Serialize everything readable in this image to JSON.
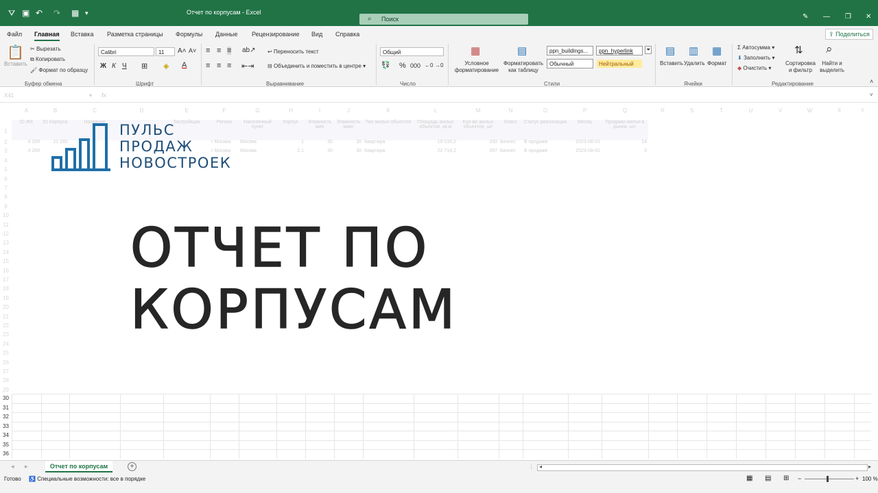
{
  "titlebar": {
    "document_title": "Отчет по корпусам  -  Excel",
    "search_placeholder": "Поиск"
  },
  "menu": {
    "tabs": [
      "Файл",
      "Главная",
      "Вставка",
      "Разметка страницы",
      "Формулы",
      "Данные",
      "Рецензирование",
      "Вид",
      "Справка"
    ],
    "active_tab": "Главная",
    "share_label": "Поделиться"
  },
  "ribbon": {
    "clipboard": {
      "paste": "Вставить",
      "cut": "Вырезать",
      "copy": "Копировать",
      "format_painter": "Формат по образцу",
      "group": "Буфер обмена"
    },
    "font": {
      "name": "Calibri",
      "size": "11",
      "bold": "Ж",
      "italic": "К",
      "underline": "Ч",
      "group": "Шрифт"
    },
    "alignment": {
      "wrap": "Переносить текст",
      "merge": "Объединить и поместить в центре",
      "group": "Выравнивание"
    },
    "number": {
      "format": "Общий",
      "group": "Число"
    },
    "styles": {
      "conditional": "Условное форматирование",
      "as_table": "Форматировать как таблицу",
      "style1": "ppn_buildings...",
      "style2": "ppn_hyperlink",
      "style3": "Обычный",
      "style4": "Нейтральный",
      "group": "Стили"
    },
    "cells": {
      "insert": "Вставить",
      "delete": "Удалить",
      "format": "Формат",
      "group": "Ячейки"
    },
    "editing": {
      "autosum": "Автосумма",
      "fill": "Заполнить",
      "clear": "Очистить",
      "sort": "Сортировка и фильтр",
      "find": "Найти и выделить",
      "group": "Редактирование"
    }
  },
  "formula_bar": {
    "name_box": "X41",
    "fx": "fx",
    "value": ""
  },
  "sheet": {
    "columns": [
      "A",
      "B",
      "C",
      "D",
      "E",
      "F",
      "G",
      "H",
      "I",
      "J",
      "K",
      "L",
      "M",
      "N",
      "O",
      "P",
      "Q",
      "R",
      "S",
      "T",
      "U",
      "V",
      "W",
      "X",
      "Y"
    ],
    "header_row": [
      "ID ЖК",
      "ID Корпуса",
      "Название",
      "",
      "Застройщик",
      "Регион",
      "Населенный пункт",
      "Корпус",
      "Этажность мин",
      "Этажность макс",
      "Тип жилых объектов",
      "Площадь жилых объектов, кв.м",
      "Кол-во жилых объектов, шт",
      "Класс",
      "Статус реализации",
      "Месяц",
      "Продажи жилья в рынок, шт."
    ],
    "rows": [
      [
        "4 269",
        "21 282",
        "",
        "",
        "",
        "г Москва",
        "Москва",
        "1",
        "30",
        "30",
        "Квартира",
        "19 016,2",
        "330",
        "Бизнес",
        "В продаже",
        "2023-08-01",
        "14"
      ],
      [
        "4 269",
        "",
        "",
        "",
        "",
        "г Москва",
        "Москва",
        "2.1",
        "30",
        "30",
        "Квартира",
        "22 714,2",
        "397",
        "Бизнес",
        "В продаже",
        "2023-08-01",
        "0"
      ]
    ],
    "row_numbers_faded": [
      "1",
      "2",
      "3",
      "4",
      "5",
      "6",
      "7",
      "8",
      "9",
      "10",
      "11",
      "12",
      "13",
      "14",
      "15",
      "16",
      "17",
      "18",
      "19",
      "20",
      "21",
      "22",
      "23",
      "24",
      "25",
      "26",
      "27",
      "28",
      "29"
    ],
    "row_numbers_visible": [
      "30",
      "31",
      "32",
      "33",
      "34",
      "35",
      "36"
    ]
  },
  "overlay": {
    "logo_lines": [
      "ПУЛЬС",
      "ПРОДАЖ",
      "НОВОСТРОЕК"
    ],
    "headline": "ОТЧЕТ ПО КОРПУСАМ"
  },
  "sheet_tabs": {
    "active": "Отчет по корпусам",
    "add": "+"
  },
  "statusbar": {
    "ready": "Готово",
    "accessibility": "Специальные возможности: все в порядке",
    "zoom": "100 %"
  },
  "colors": {
    "excel_green": "#217346",
    "logo_blue": "#1f4e79",
    "headline": "#262626"
  }
}
